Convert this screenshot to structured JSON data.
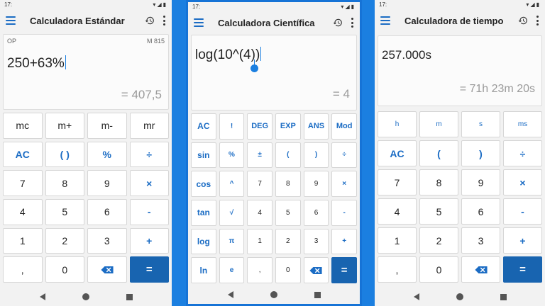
{
  "screens": [
    {
      "time": "17:",
      "title": "Calculadora Estándar",
      "display": {
        "mode": "OP",
        "memory": "M 815",
        "expression": "250+63%",
        "result": "= 407,5"
      },
      "keys": [
        "mc",
        "m+",
        "m-",
        "mr",
        "AC",
        "( )",
        "%",
        "÷",
        "7",
        "8",
        "9",
        "×",
        "4",
        "5",
        "6",
        "-",
        "1",
        "2",
        "3",
        "+",
        ",",
        "0",
        "backspace",
        "="
      ]
    },
    {
      "time": "17:",
      "title": "Calculadora Científica",
      "display": {
        "expression": "log(10^(4))",
        "result": "= 4"
      },
      "keys": [
        "AC",
        "!",
        "DEG",
        "EXP",
        "ANS",
        "Mod",
        "sin",
        "%",
        "±",
        "(",
        ")",
        "÷",
        "cos",
        "^",
        "7",
        "8",
        "9",
        "×",
        "tan",
        "√",
        "4",
        "5",
        "6",
        "-",
        "log",
        "π",
        "1",
        "2",
        "3",
        "+",
        "ln",
        "e",
        ",",
        "0",
        "backspace",
        "="
      ]
    },
    {
      "time": "17:",
      "title": "Calculadora de tiempo",
      "display": {
        "expression": "257.000s",
        "result": "= 71h 23m 20s"
      },
      "keys": [
        "h",
        "m",
        "s",
        "ms",
        "AC",
        "(",
        ")",
        "÷",
        "7",
        "8",
        "9",
        "×",
        "4",
        "5",
        "6",
        "-",
        "1",
        "2",
        "3",
        "+",
        ",",
        "0",
        "backspace",
        "="
      ]
    }
  ],
  "icons": {
    "menu": "menu-icon",
    "history": "history-icon",
    "more": "more-vert-icon",
    "backspace": "backspace-icon"
  },
  "colors": {
    "accent": "#1b6cc4",
    "equals": "#1864b0",
    "frame": "#1b7fe0"
  }
}
